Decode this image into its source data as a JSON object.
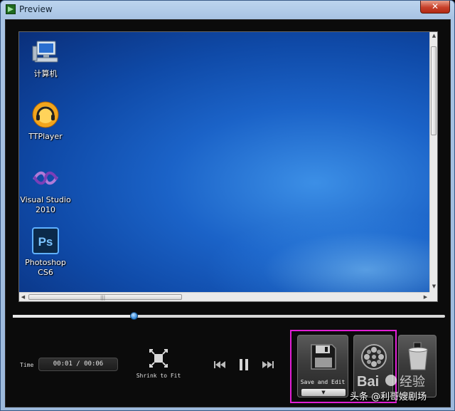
{
  "window": {
    "title": "Preview",
    "close_glyph": "✕"
  },
  "desktop": {
    "icons": [
      {
        "name": "computer-icon",
        "label": "计算机"
      },
      {
        "name": "ttplayer-icon",
        "label": "TTPlayer"
      },
      {
        "name": "visual-studio-icon",
        "label": "Visual Studio 2010"
      },
      {
        "name": "photoshop-icon",
        "label": "Photoshop CS6"
      }
    ]
  },
  "scrollbars": {
    "up_arrow": "▲",
    "down_arrow": "▼",
    "left_arrow": "◀",
    "right_arrow": "▶",
    "grip": "|||"
  },
  "timeline": {
    "progress": 0.28
  },
  "controls": {
    "time_label": "Time",
    "time_value": "00:01 / 00:06",
    "shrink_label": "Shrink to Fit",
    "save_label": "Save and Edit",
    "dropdown_glyph": "▼"
  },
  "colors": {
    "highlight": "#e21fd6",
    "knob": "#3b8fe0"
  },
  "watermark": {
    "text": "头条 @利哥嫂剧场",
    "logo": "Bai 经验"
  }
}
